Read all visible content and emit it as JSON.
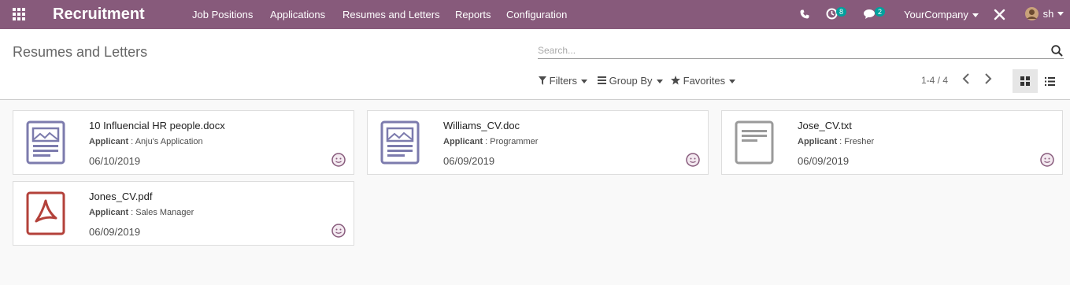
{
  "app": {
    "title": "Recruitment",
    "menu": [
      "Job Positions",
      "Applications",
      "Resumes and Letters",
      "Reports",
      "Configuration"
    ],
    "activity_count": "8",
    "message_count": "2",
    "company": "YourCompany",
    "user": "sh",
    "brand_color": "#875a7b"
  },
  "control": {
    "page_title": "Resumes and Letters",
    "search_placeholder": "Search...",
    "filters_label": "Filters",
    "group_by_label": "Group By",
    "favorites_label": "Favorites",
    "pager": "1-4 / 4",
    "active_view": "kanban"
  },
  "documents": [
    {
      "name": "10 Influencial HR people.docx",
      "applicant_label": "Applicant",
      "applicant": "Anju's Application",
      "date": "06/10/2019",
      "icon": "document-image-icon"
    },
    {
      "name": "Williams_CV.doc",
      "applicant_label": "Applicant",
      "applicant": "Programmer",
      "date": "06/09/2019",
      "icon": "document-image-icon"
    },
    {
      "name": "Jose_CV.txt",
      "applicant_label": "Applicant",
      "applicant": "Fresher",
      "date": "06/09/2019",
      "icon": "text-file-icon"
    },
    {
      "name": "Jones_CV.pdf",
      "applicant_label": "Applicant",
      "applicant": "Sales Manager",
      "date": "06/09/2019",
      "icon": "pdf-file-icon"
    }
  ]
}
